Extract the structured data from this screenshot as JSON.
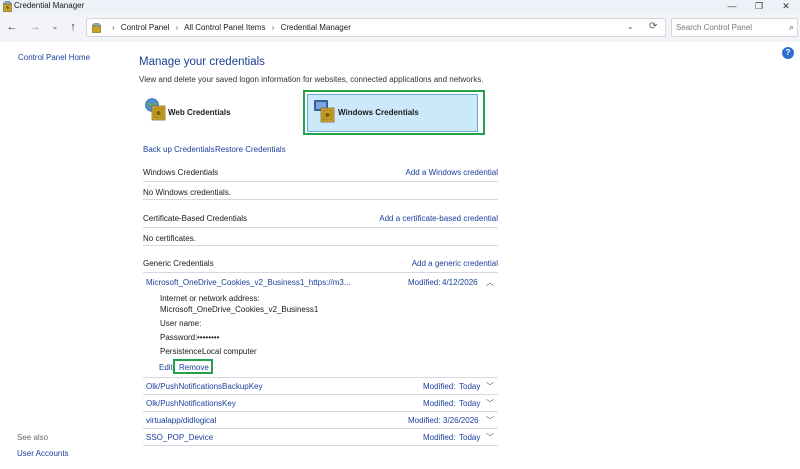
{
  "window": {
    "title": "Credential Manager",
    "minimize": "—",
    "maximize": "❐",
    "close": "✕"
  },
  "nav": {
    "back": "←",
    "forward": "→",
    "recent": "⌄",
    "up": "↑",
    "breadcrumbs": [
      "Control Panel",
      "All Control Panel Items",
      "Credential Manager"
    ],
    "crumb_separator": "›",
    "dropdown": "⌄",
    "refresh": "⟳",
    "search_placeholder": "Search Control Panel",
    "search_icon": "⌕"
  },
  "sidebar": {
    "home": "Control Panel Home",
    "see_also": "See also",
    "user_accounts": "User Accounts"
  },
  "help": "?",
  "main": {
    "title": "Manage your credentials",
    "description": "View and delete your saved logon information for websites, connected applications and networks.",
    "web_tile": "Web Credentials",
    "windows_tile": "Windows Credentials",
    "backup": "Back up Credentials",
    "restore": "Restore Credentials"
  },
  "sections": {
    "windows": {
      "title": "Windows Credentials",
      "add": "Add a Windows credential",
      "empty": "No Windows credentials."
    },
    "certificate": {
      "title": "Certificate-Based Credentials",
      "add": "Add a certificate-based credential",
      "empty": "No certificates."
    },
    "generic": {
      "title": "Generic Credentials",
      "add": "Add a generic credential"
    }
  },
  "expanded": {
    "name": "Microsoft_OneDrive_Cookies_v2_Business1_https://m3...",
    "modified_label": "Modified:",
    "modified_value": "4/12/2026",
    "chevron": "︿",
    "address_label": "Internet or network address:",
    "address_value": "Microsoft_OneDrive_Cookies_v2_Business1",
    "username_label": "User name:",
    "password_label": "Password:",
    "password_value": "••••••••",
    "persistence_label": "Persistence:",
    "persistence_value": "Local computer",
    "edit": "Edit",
    "remove": "Remove"
  },
  "generic_rows": [
    {
      "name": "Olk/PushNotificationsBackupKey",
      "modified_label": "Modified:",
      "modified_value": "Today",
      "chevron": "﹀"
    },
    {
      "name": "Olk/PushNotificationsKey",
      "modified_label": "Modified:",
      "modified_value": "Today",
      "chevron": "﹀"
    },
    {
      "name": "virtualapp/didlogical",
      "modified_label": "Modified:",
      "modified_value": "3/26/2026",
      "chevron": "﹀"
    },
    {
      "name": "SSO_POP_Device",
      "modified_label": "Modified:",
      "modified_value": "Today",
      "chevron": "﹀"
    }
  ],
  "colors": {
    "accent_link": "#1a3f9c",
    "title_blue": "#1c3e94",
    "highlight_green": "#22a34a",
    "selected_tile": "#cce8fb"
  }
}
